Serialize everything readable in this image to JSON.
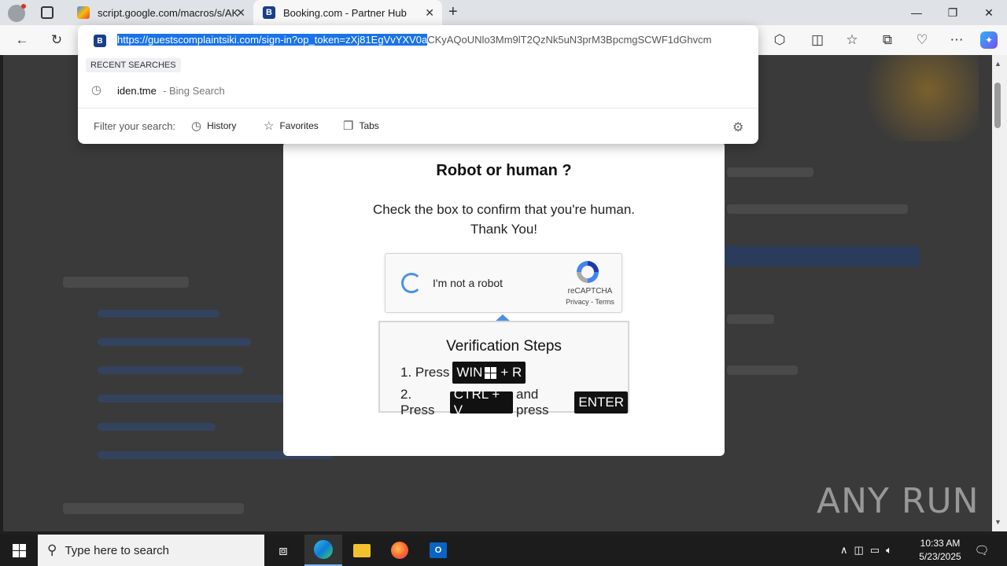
{
  "tabs": [
    {
      "title": "script.google.com/macros/s/AKf",
      "icon": "google-apps-script-icon"
    },
    {
      "title": "Booking.com - Partner Hub",
      "icon": "booking-b-icon",
      "favicon_letter": "B"
    }
  ],
  "address": {
    "selected": "https://guestscomplaintsiki.com/sign-in?op_token=zXj81EgVvYXV0a",
    "rest": "CKyAQoUNlo3Mm9lT2QzNk5uN3prM3BpcmgSCWF1dGhvcm"
  },
  "dropdown": {
    "recent_label": "RECENT SEARCHES",
    "recent_query": "iden.tme",
    "recent_source": "- Bing Search",
    "filter_label": "Filter your search:",
    "filters": [
      "History",
      "Favorites",
      "Tabs"
    ]
  },
  "modal": {
    "title": "Robot or human ?",
    "text_line1": "Check the box to confirm that you're human.",
    "text_line2": "Thank You!",
    "captcha_label": "I'm not a robot",
    "captcha_brand": "reCAPTCHA",
    "captcha_links": "Privacy - Terms",
    "steps_title": "Verification Steps",
    "step1_prefix": "1. Press",
    "step1_key_a": "WIN",
    "step1_key_b": "+ R",
    "step2_prefix": "2. Press",
    "step2_key": "CTRL + V",
    "step2_mid": "and press",
    "step2_key2": "ENTER"
  },
  "watermark": "ANY RUN",
  "taskbar": {
    "search_placeholder": "Type here to search",
    "time": "10:33 AM",
    "date": "5/23/2025"
  },
  "colors": {
    "accent": "#1a73e8",
    "captcha_blue": "#4a90e2",
    "booking_blue": "#1a3e8a"
  }
}
